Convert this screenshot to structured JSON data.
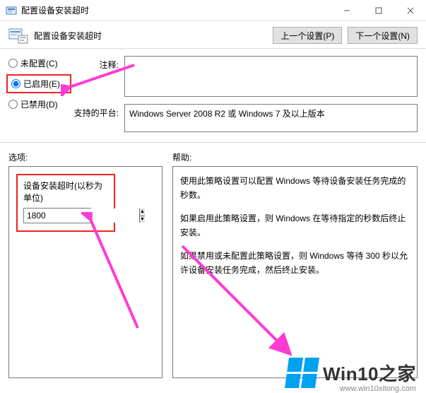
{
  "window": {
    "title": "配置设备安装超时"
  },
  "header": {
    "title": "配置设备安装超时",
    "prev": "上一个设置(P)",
    "next": "下一个设置(N)"
  },
  "radios": {
    "not_configured": "未配置(C)",
    "enabled": "已启用(E)",
    "disabled": "已禁用(D)"
  },
  "fields": {
    "comment_label": "注释:",
    "comment_value": "",
    "platform_label": "支持的平台:",
    "platform_value": "Windows Server 2008 R2 或 Windows 7 及以上版本"
  },
  "section_labels": {
    "options": "选项:",
    "help": "帮助:"
  },
  "options": {
    "timeout_label": "设备安装超时(以秒为单位)",
    "timeout_value": "1800"
  },
  "help": {
    "p1": "使用此策略设置可以配置 Windows 等待设备安装任务完成的秒数。",
    "p2": "如果启用此策略设置，则 Windows 在等待指定的秒数后终止安装。",
    "p3": "如果禁用或未配置此策略设置，则 Windows 等待 300 秒以允许设备安装任务完成，然后终止安装。"
  },
  "watermark": {
    "brand": "Win10之家",
    "url": "www.win10xitong.com"
  }
}
